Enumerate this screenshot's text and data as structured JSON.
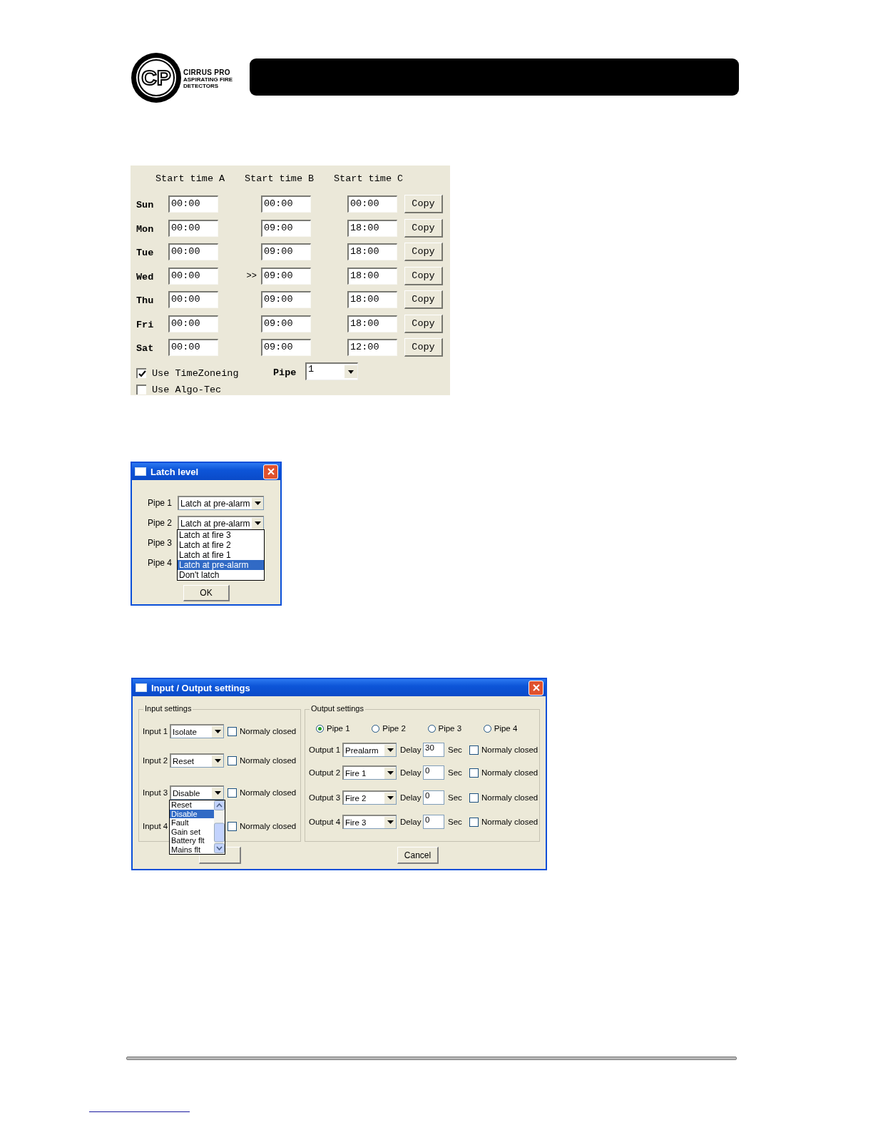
{
  "header": {
    "logo": {
      "monogram": "CP",
      "name": "CIRRUS PRO",
      "tagline": "ASPIRATING FIRE DETECTORS"
    }
  },
  "timezone_panel": {
    "columns": [
      "Start time A",
      "Start time B",
      "Start time C"
    ],
    "rows": [
      {
        "day": "Sun",
        "a": "00:00",
        "b": "00:00",
        "c": "00:00",
        "button": "Copy"
      },
      {
        "day": "Mon",
        "a": "00:00",
        "b": "09:00",
        "c": "18:00",
        "button": "Copy"
      },
      {
        "day": "Tue",
        "a": "00:00",
        "b": "09:00",
        "c": "18:00",
        "button": "Copy"
      },
      {
        "day": "Wed",
        "a": "00:00",
        "marker": ">>",
        "b": "09:00",
        "c": "18:00",
        "button": "Copy"
      },
      {
        "day": "Thu",
        "a": "00:00",
        "b": "09:00",
        "c": "18:00",
        "button": "Copy"
      },
      {
        "day": "Fri",
        "a": "00:00",
        "b": "09:00",
        "c": "18:00",
        "button": "Copy"
      },
      {
        "day": "Sat",
        "a": "00:00",
        "b": "09:00",
        "c": "12:00",
        "button": "Copy"
      }
    ],
    "use_timezoneing": {
      "label": "Use TimeZoneing",
      "checked": true
    },
    "use_algo_tec": {
      "label": "Use Algo-Tec",
      "checked": false
    },
    "pipe": {
      "label": "Pipe",
      "value": "1"
    }
  },
  "latch_dialog": {
    "title": "Latch level",
    "rows": [
      {
        "label": "Pipe 1",
        "value": "Latch at pre-alarm"
      },
      {
        "label": "Pipe 2",
        "value": "Latch at pre-alarm"
      },
      {
        "label": "Pipe 3"
      },
      {
        "label": "Pipe 4"
      }
    ],
    "dropdown": [
      {
        "label": "Latch at fire 3",
        "selected": false
      },
      {
        "label": "Latch at fire 2",
        "selected": false
      },
      {
        "label": "Latch at fire 1",
        "selected": false
      },
      {
        "label": "Latch at pre-alarm",
        "selected": true
      },
      {
        "label": "Don't latch",
        "selected": false
      }
    ],
    "ok": "OK"
  },
  "io_dialog": {
    "title": "Input / Output settings",
    "input_settings": {
      "legend": "Input settings",
      "rows": [
        {
          "label": "Input 1",
          "value": "Isolate",
          "nc_label": "Normaly closed",
          "checked": false
        },
        {
          "label": "Input 2",
          "value": "Reset",
          "nc_label": "Normaly closed",
          "checked": false
        },
        {
          "label": "Input 3",
          "value": "Disable",
          "nc_label": "Normaly closed",
          "checked": false
        },
        {
          "label": "Input 4",
          "nc_label": "Normaly closed",
          "checked": false
        }
      ],
      "dropdown": [
        {
          "label": "Reset",
          "selected": false
        },
        {
          "label": "Disable",
          "selected": true
        },
        {
          "label": "Fault",
          "selected": false
        },
        {
          "label": "Gain set",
          "selected": false
        },
        {
          "label": "Battery flt",
          "selected": false
        },
        {
          "label": "Mains flt",
          "selected": false
        }
      ]
    },
    "output_settings": {
      "legend": "Output settings",
      "pipes": [
        {
          "label": "Pipe 1",
          "selected": true
        },
        {
          "label": "Pipe 2",
          "selected": false
        },
        {
          "label": "Pipe 3",
          "selected": false
        },
        {
          "label": "Pipe 4",
          "selected": false
        }
      ],
      "rows": [
        {
          "label": "Output 1",
          "value": "Prealarm",
          "delay_label": "Delay",
          "delay": "30",
          "unit": "Sec",
          "nc_label": "Normaly closed",
          "checked": false
        },
        {
          "label": "Output 2",
          "value": "Fire 1",
          "delay_label": "Delay",
          "delay": "0",
          "unit": "Sec",
          "nc_label": "Normaly closed",
          "checked": false
        },
        {
          "label": "Output 3",
          "value": "Fire 2",
          "delay_label": "Delay",
          "delay": "0",
          "unit": "Sec",
          "nc_label": "Normaly closed",
          "checked": false
        },
        {
          "label": "Output 4",
          "value": "Fire 3",
          "delay_label": "Delay",
          "delay": "0",
          "unit": "Sec",
          "nc_label": "Normaly closed",
          "checked": false
        }
      ]
    },
    "cancel": "Cancel"
  }
}
